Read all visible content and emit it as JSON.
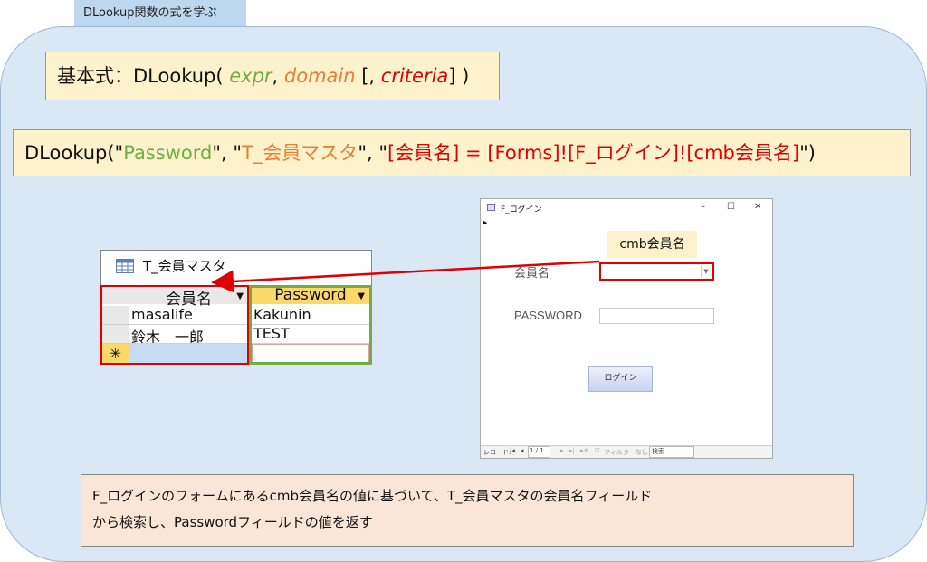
{
  "header": {
    "tab_label": "DLookup関数の式を学ぶ"
  },
  "formula_basic": {
    "prefix": "基本式：DLookup( ",
    "expr": "expr",
    "sep1": ", ",
    "domain": "domain",
    "sep2": " [, ",
    "criteria": "criteria",
    "suffix": "] )"
  },
  "formula_example": {
    "prefix": "DLookup(\"",
    "expr": "Password",
    "sep1": "\", \"",
    "domain": "T_会員マスタ",
    "sep2": "\", \"",
    "criteria": "[会員名] = [Forms]![F_ログイン]![cmb会員名]",
    "suffix": "\")"
  },
  "table_window": {
    "title": "T_会員マスタ",
    "columns": [
      "会員名",
      "Password"
    ],
    "rows": [
      [
        "masalife",
        "Kakunin"
      ],
      [
        "鈴木　一郎",
        "TEST"
      ]
    ],
    "new_row_marker": "✳"
  },
  "login_form": {
    "title": "F_ログイン",
    "window_controls": [
      "–",
      "☐",
      "✕"
    ],
    "callout": "cmb会員名",
    "member_label": "会員名",
    "password_label": "PASSWORD",
    "login_button": "ログイン",
    "navbar": {
      "record_label": "レコード:",
      "record_position": "1 / 1",
      "filter_label": "フィルターなし",
      "search_label": "検索"
    }
  },
  "description": {
    "line1": "F_ログインのフォームにあるcmb会員名の値に基づいて、T_会員マスタの会員名フィールド",
    "line2": "から検索し、Passwordフィールドの値を返す"
  },
  "colors": {
    "expr": "#70ad47",
    "domain": "#ed7d31",
    "criteria": "#e00000",
    "highlight_red": "#e00000",
    "highlight_green": "#70ad47"
  }
}
